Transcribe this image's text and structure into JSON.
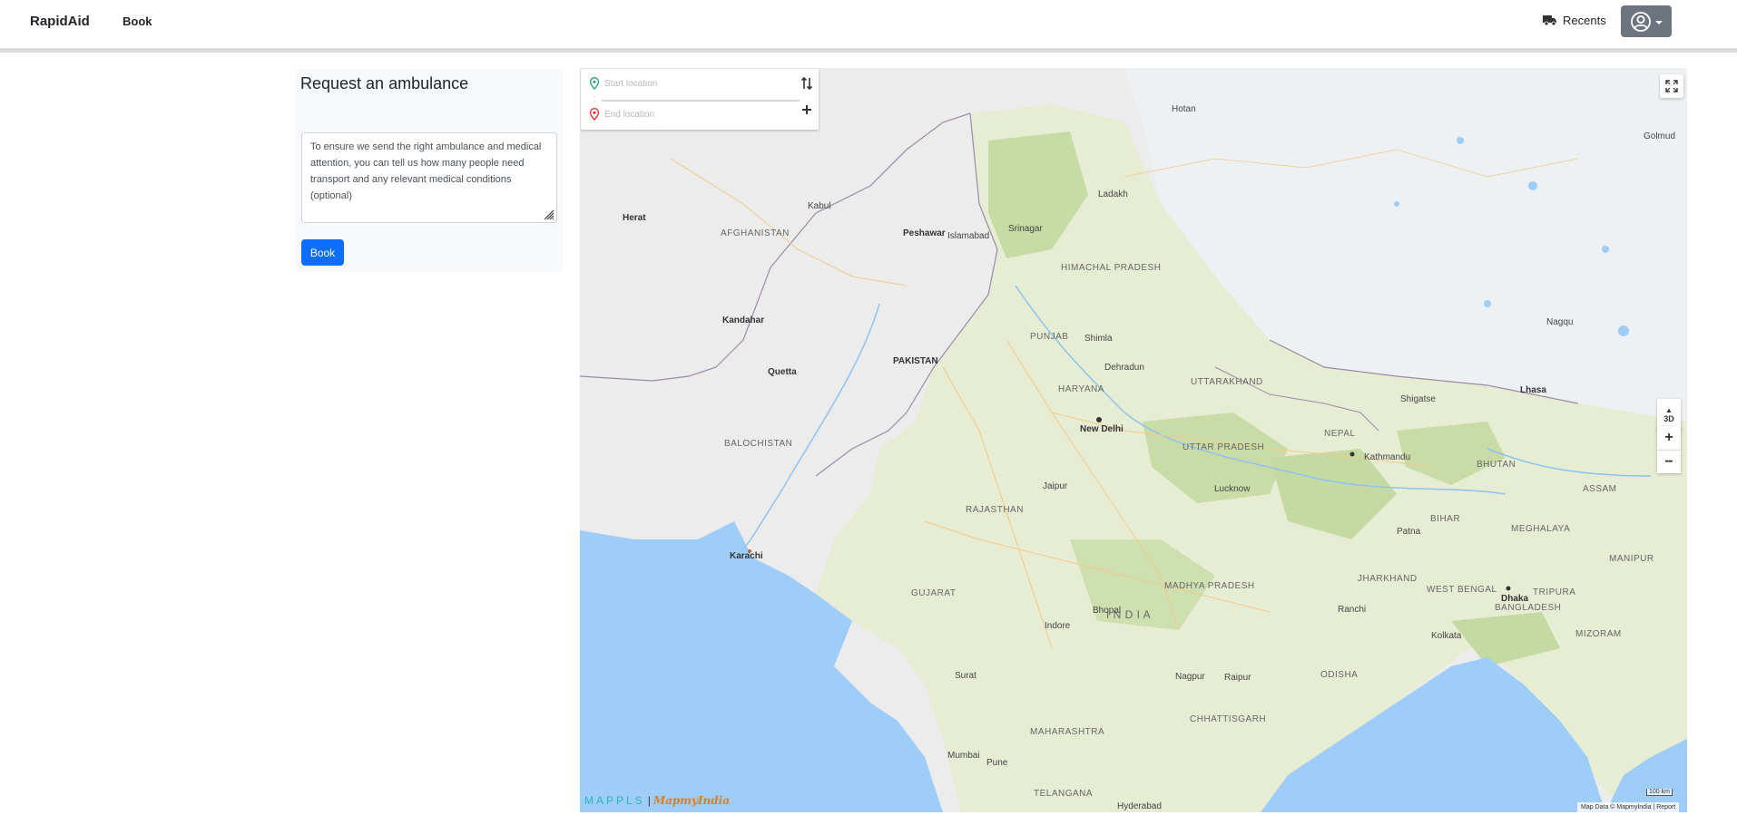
{
  "navbar": {
    "brand": "RapidAid",
    "links": [
      {
        "label": "Book"
      }
    ],
    "recents_label": "Recents"
  },
  "booking_panel": {
    "title": "Request an ambulance",
    "notes_placeholder": "To ensure we send the right ambulance and medical attention, you can tell us how many people need transport and any relevant medical conditions (optional)",
    "book_button": "Book"
  },
  "map": {
    "start_placeholder": "Start location",
    "end_placeholder": "End location",
    "compass_label": "3D",
    "zoom_in_label": "+",
    "zoom_out_label": "−",
    "logo_mappls": "MAPPLS",
    "logo_separator": "|",
    "logo_mapmyindia": "MapmyIndia",
    "attribution": "Map Data © MapmyIndia | Report",
    "scale_label": "100 km",
    "labels": {
      "karachi": "Karachi",
      "new_delhi": "New Delhi",
      "india": "I N D I A",
      "pakistan": "PAKISTAN",
      "nepal": "NEPAL",
      "bhutan": "BHUTAN",
      "bangladesh": "BANGLADESH",
      "afghanistan": "AFGHANISTAN",
      "lhasa": "Lhasa",
      "quetta": "Quetta",
      "kandahar": "Kandahar",
      "herat": "Herat",
      "kathmandu": "Kathmandu",
      "dhaka": "Dhaka",
      "kolkata": "Kolkata",
      "mumbai": "Mumbai",
      "hyderabad": "Hyderabad",
      "gujarat": "GUJARAT",
      "rajasthan": "RAJASTHAN",
      "madhya_pradesh": "MADHYA PRADESH",
      "uttar_pradesh": "UTTAR PRADESH",
      "maharashtra": "MAHARASHTRA",
      "bihar": "BIHAR",
      "jharkhand": "JHARKHAND",
      "odisha": "ODISHA",
      "chhattisgarh": "CHHATTISGARH",
      "telangana": "TELANGANA",
      "haryana": "HARYANA",
      "punjab": "PUNJAB",
      "uttarakhand": "UTTARAKHAND",
      "himachal": "HIMACHAL PRADESH",
      "ladakh": "Ladakh",
      "meghalaya": "MEGHALAYA",
      "assam": "ASSAM",
      "tripura": "TRIPURA",
      "mizoram": "MIZORAM",
      "manipur": "MANIPUR",
      "west_bengal": "WEST BENGAL",
      "balochistan": "BALOCHISTAN",
      "islamabad": "Islamabad",
      "peshawar": "Peshawar",
      "kabul": "Kabul",
      "srinagar": "Srinagar",
      "jaipur": "Jaipur",
      "lucknow": "Lucknow",
      "patna": "Patna",
      "bhopal": "Bhopal",
      "nagpur": "Nagpur",
      "raipur": "Raipur",
      "ranchi": "Ranchi",
      "surat": "Surat",
      "indore": "Indore",
      "pune": "Pune",
      "shimla": "Shimla",
      "dehradun": "Dehradun",
      "hotan": "Hotan",
      "golmud": "Golmud",
      "nagqu": "Nagqu",
      "shigatse": "Shigatse"
    }
  },
  "colors": {
    "primary": "#0d6efd",
    "secondary": "#6c757d",
    "panel_bg": "#f8f9fa",
    "sea": "#9fcdf9",
    "land_green": "#dfe8cc",
    "land_grey": "#ececec"
  },
  "icons": [
    "truck-icon",
    "user-circle-icon",
    "location-pin-icon",
    "swap-icon",
    "plus-icon",
    "fullscreen-icon"
  ]
}
